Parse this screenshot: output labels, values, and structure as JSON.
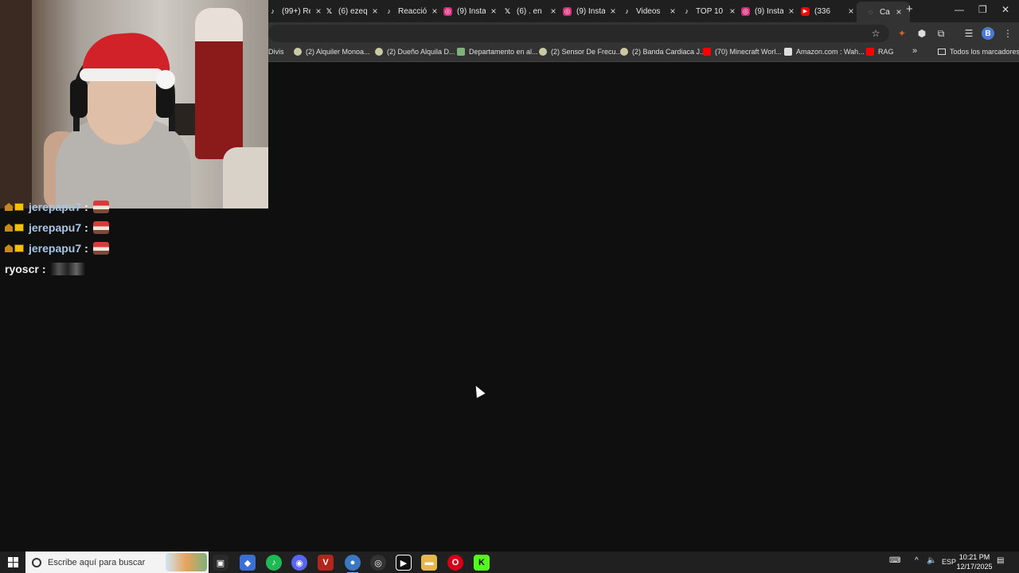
{
  "browser": {
    "tabs": [
      {
        "label": "(99+) Re",
        "icon": "tiktok-icon"
      },
      {
        "label": "(6) ezeq",
        "icon": "x-icon"
      },
      {
        "label": "Reacción",
        "icon": "tiktok-icon"
      },
      {
        "label": "(9) Insta",
        "icon": "instagram-icon"
      },
      {
        "label": "(6) . en",
        "icon": "x-icon"
      },
      {
        "label": "(9) Insta",
        "icon": "instagram-icon"
      },
      {
        "label": "Videos",
        "icon": "tiktok-icon"
      },
      {
        "label": "TOP 10",
        "icon": "tiktok-icon"
      },
      {
        "label": "(9) Insta",
        "icon": "instagram-icon"
      },
      {
        "label": "(336",
        "icon": "youtube-icon"
      },
      {
        "label": "Ca",
        "icon": "loading-icon",
        "active": true
      }
    ],
    "new_tab": "+",
    "window_controls": {
      "minimize": "—",
      "restore": "❐",
      "close": "✕"
    },
    "profile_initial": "B",
    "bookmarks": [
      {
        "label": "Divis",
        "icon_color": "#888888"
      },
      {
        "label": "(2) Alquiler Monoa...",
        "icon_color": "#c9c9a3"
      },
      {
        "label": "(2) Dueño Alquila D...",
        "icon_color": "#c9c9a3"
      },
      {
        "label": "Departamento en al...",
        "icon_color": "#7fb27a"
      },
      {
        "label": "(2) Sensor De Frecu...",
        "icon_color": "#c9c9a3"
      },
      {
        "label": "(2) Banda Cardiaca J...",
        "icon_color": "#c9c9a3"
      },
      {
        "label": "(70) Minecraft Worl...",
        "icon_color": "#ff0000"
      },
      {
        "label": "Amazon.com : Wah...",
        "icon_color": "#dddddd"
      },
      {
        "label": "RAG",
        "icon_color": "#ff0000"
      }
    ],
    "bookmarks_more": "»",
    "all_bookmarks": "Todos los marcadores"
  },
  "chat": {
    "messages": [
      {
        "user": "jerepapu7",
        "badges": true,
        "emote": "santa-emote"
      },
      {
        "user": "jerepapu7",
        "badges": true,
        "emote": "santa-emote"
      },
      {
        "user": "jerepapu7",
        "badges": true,
        "emote": "santa-emote"
      },
      {
        "user": "ryoscr",
        "badges": false,
        "emote": "dark-emote"
      }
    ],
    "separator": ":"
  },
  "taskbar": {
    "search_placeholder": "Escribe aquí para buscar",
    "apps": [
      {
        "name": "task-view",
        "color": "#2a2a2a",
        "glyph": "▣"
      },
      {
        "name": "copilot",
        "color": "#3b6fd8",
        "glyph": "◆"
      },
      {
        "name": "spotify",
        "color": "#1db954",
        "glyph": "♪"
      },
      {
        "name": "discord",
        "color": "#5865f2",
        "glyph": "◉"
      },
      {
        "name": "voicemeeter",
        "color": "#b3261e",
        "glyph": "V"
      },
      {
        "name": "chrome",
        "color": "#3a78c3",
        "glyph": "●",
        "active": true
      },
      {
        "name": "obs",
        "color": "#333333",
        "glyph": "◎"
      },
      {
        "name": "capcut",
        "color": "#111111",
        "glyph": "▶"
      },
      {
        "name": "file-explorer",
        "color": "#e6b84a",
        "glyph": "▬"
      },
      {
        "name": "opera",
        "color": "#d4001a",
        "glyph": "O"
      },
      {
        "name": "kick",
        "color": "#53fc18",
        "glyph": "K"
      }
    ],
    "language": "ESP",
    "time": "10:21 PM",
    "date": "12/17/2025"
  }
}
